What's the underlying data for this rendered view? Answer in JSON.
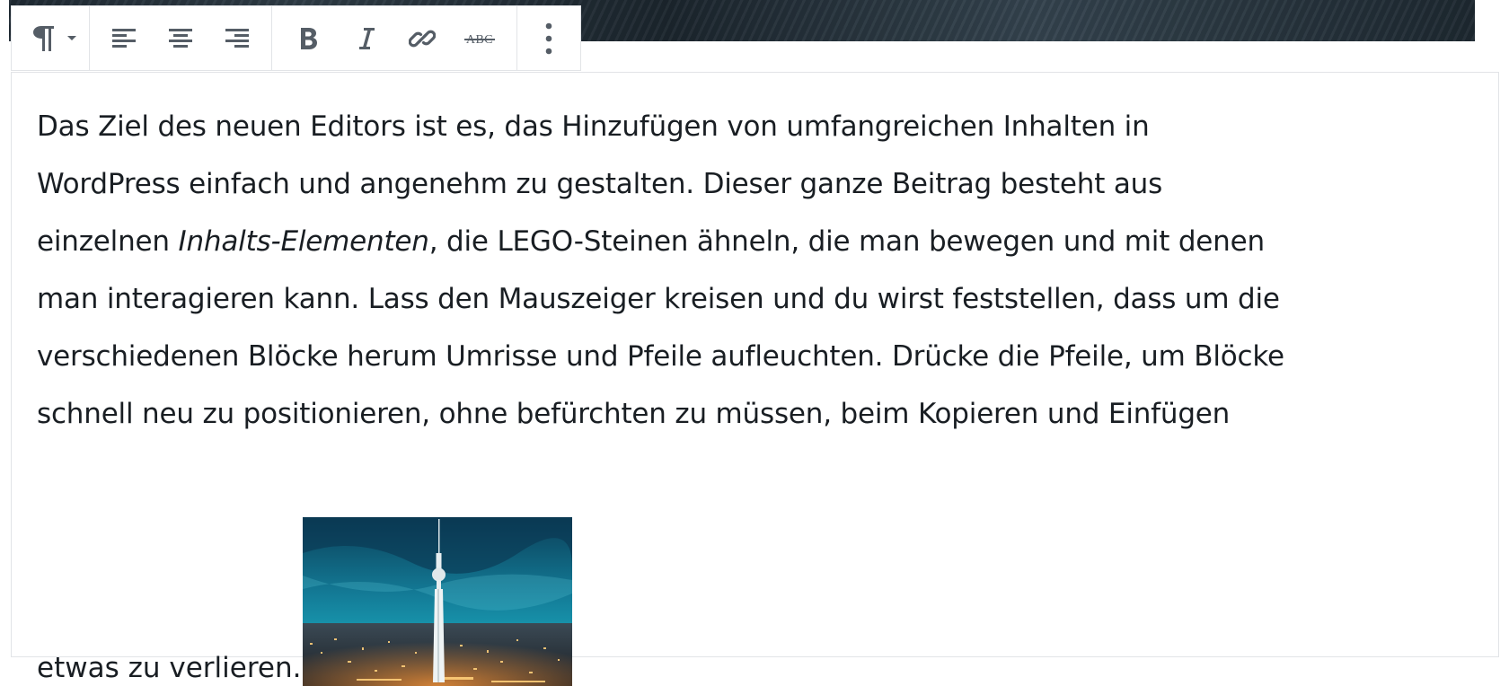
{
  "toolbar": {
    "buttons": [
      {
        "name": "paragraph-block-switcher",
        "icon": "paragraph-icon",
        "dropdown": true
      },
      {
        "name": "align-left",
        "icon": "align-left-icon"
      },
      {
        "name": "align-center",
        "icon": "align-center-icon"
      },
      {
        "name": "align-right",
        "icon": "align-right-icon"
      },
      {
        "name": "bold",
        "icon": "bold-icon"
      },
      {
        "name": "italic",
        "icon": "italic-icon"
      },
      {
        "name": "link",
        "icon": "link-icon"
      },
      {
        "name": "strikethrough",
        "icon": "strikethrough-icon",
        "label": "ABC"
      },
      {
        "name": "more-options",
        "icon": "more-vertical-icon"
      }
    ]
  },
  "paragraph": {
    "line1": "Das Ziel des neuen Editors ist es, das Hinzufügen von umfangreichen Inhalten in",
    "line2": "WordPress einfach und angenehm zu gestalten. Dieser ganze Beitrag besteht aus",
    "line3_before": "einzelnen ",
    "line3_emphasis": "Inhalts-Elementen",
    "line3_after": ", die LEGO-Steinen ähneln, die man bewegen und mit denen",
    "line4": "man interagieren kann. Lass den Mauszeiger kreisen und du wirst feststellen, dass um die",
    "line5": "verschiedenen Blöcke herum Umrisse und Pfeile aufleuchten. Drücke die Pfeile, um Blöcke",
    "line6": "schnell neu zu positionieren, ohne befürchten zu müssen, beim Kopieren und Einfügen",
    "line7": "etwas zu verlieren."
  },
  "colors": {
    "text": "#191e23",
    "icon": "#555d66",
    "border": "#e2e4e7",
    "image_sky": "#0f5f7a",
    "image_city_lights": "#f0a040"
  }
}
